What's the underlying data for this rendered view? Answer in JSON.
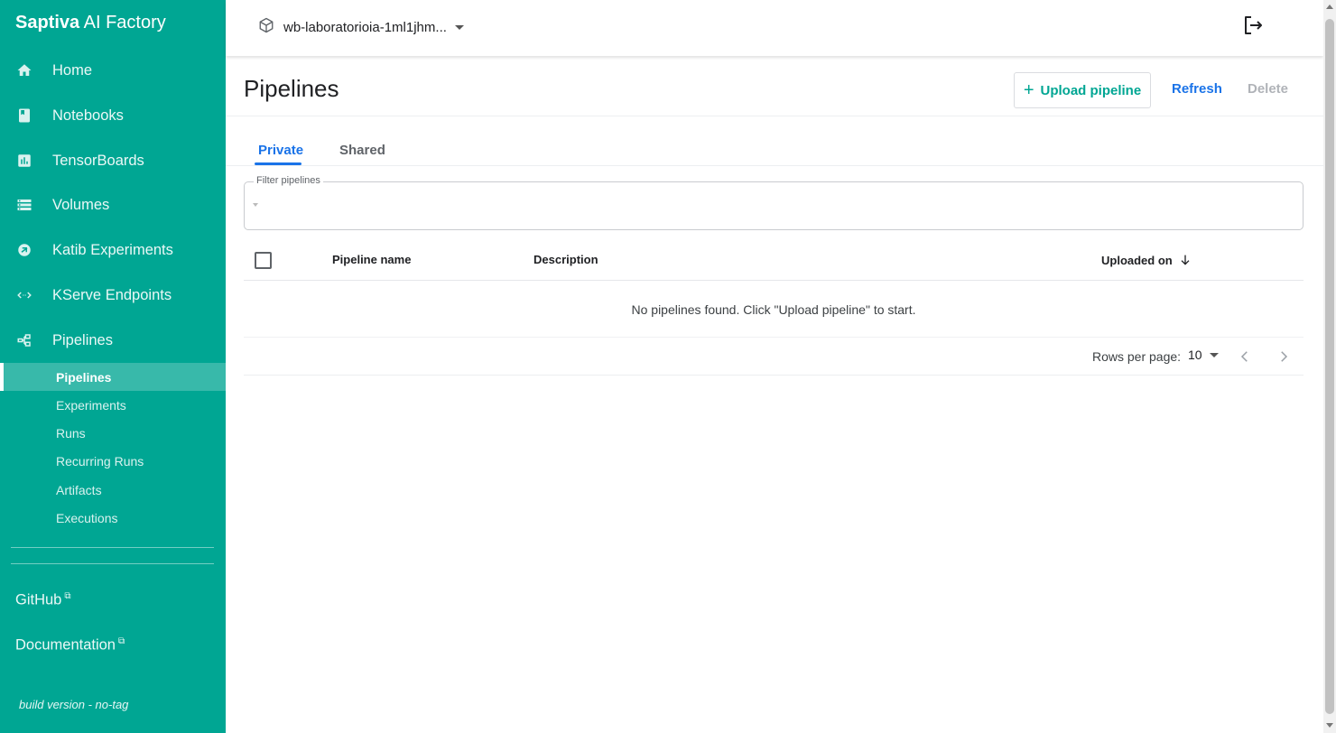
{
  "brand": {
    "bold": "Saptiva",
    "rest": " AI Factory"
  },
  "sidebar": {
    "items": [
      {
        "label": "Home",
        "icon": "home-icon"
      },
      {
        "label": "Notebooks",
        "icon": "notebook-icon"
      },
      {
        "label": "TensorBoards",
        "icon": "chart-icon"
      },
      {
        "label": "Volumes",
        "icon": "storage-icon"
      },
      {
        "label": "Katib Experiments",
        "icon": "katib-icon"
      },
      {
        "label": "KServe Endpoints",
        "icon": "code-arrows-icon"
      },
      {
        "label": "Pipelines",
        "icon": "pipelines-icon"
      }
    ],
    "subitems": [
      {
        "label": "Pipelines",
        "active": true
      },
      {
        "label": "Experiments"
      },
      {
        "label": "Runs"
      },
      {
        "label": "Recurring Runs"
      },
      {
        "label": "Artifacts"
      },
      {
        "label": "Executions"
      }
    ],
    "links": [
      {
        "label": "GitHub",
        "icon": "external-link-icon"
      },
      {
        "label": "Documentation",
        "icon": "external-link-icon"
      }
    ],
    "build": "build version - no-tag"
  },
  "topbar": {
    "namespace": "wb-laboratorioia-1ml1jhm...",
    "namespace_icon": "cube-icon",
    "logout_icon": "logout-icon"
  },
  "page": {
    "title": "Pipelines",
    "upload_label": "Upload pipeline",
    "upload_icon": "+",
    "refresh_label": "Refresh",
    "delete_label": "Delete"
  },
  "tabs": [
    {
      "label": "Private",
      "active": true
    },
    {
      "label": "Shared",
      "active": false
    }
  ],
  "filter": {
    "label": "Filter pipelines",
    "value": "",
    "placeholder": ""
  },
  "table": {
    "columns": [
      "Pipeline name",
      "Description",
      "Uploaded on"
    ],
    "sort_icon": "arrow-down-icon",
    "empty_message": "No pipelines found. Click \"Upload pipeline\" to start."
  },
  "pagination": {
    "rows_label": "Rows per page:",
    "rows_value": "10"
  },
  "colors": {
    "sidebar": "#00a693",
    "accent": "#1a73e8",
    "upload": "#00a693",
    "disabled": "#b0b3b8"
  }
}
